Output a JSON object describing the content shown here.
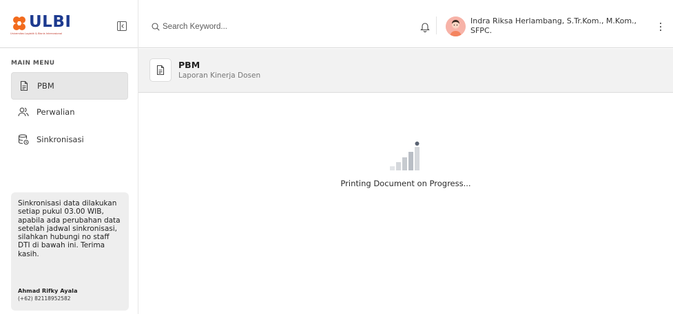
{
  "brand": {
    "name": "ULBI",
    "tagline": "Universitas Logistik & Bisnis Internasional",
    "logo_color": "#f26b1d",
    "text_color": "#1d3a8f"
  },
  "sidebar": {
    "menu_title": "MAIN MENU",
    "items": [
      {
        "label": "PBM",
        "icon": "document-icon",
        "active": true
      },
      {
        "label": "Perwalian",
        "icon": "users-icon",
        "active": false
      },
      {
        "label": "Sinkronisasi",
        "icon": "database-sync-icon",
        "active": false
      }
    ],
    "info": {
      "text": "Sinkronisasi data dilakukan setiap pukul 03.00 WIB, apabila ada perubahan data setelah jadwal sinkronisasi, silahkan hubungi no staff DTI di bawah ini. Terima kasih.",
      "contact_name": "Ahmad Rifky Ayala",
      "contact_phone": "(+62) 82118952582"
    }
  },
  "topbar": {
    "search_placeholder": "Search Keyword...",
    "user_name": "Indra Riksa Herlambang, S.Tr.Kom., M.Kom., SFPC."
  },
  "page_header": {
    "title": "PBM",
    "subtitle": "Laporan Kinerja Dosen"
  },
  "main": {
    "status_text": "Printing Document on Progress...",
    "loader_color": "#5a6373"
  }
}
